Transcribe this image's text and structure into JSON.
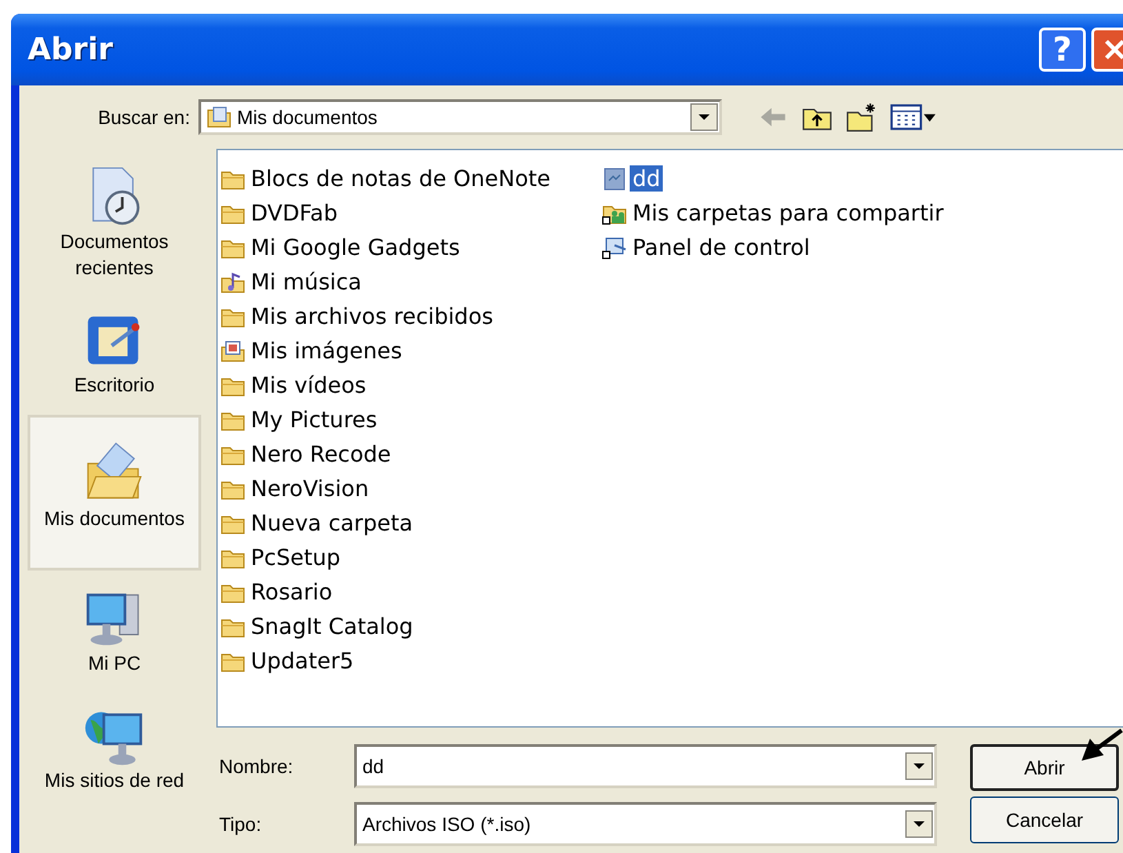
{
  "window": {
    "title": "Abrir",
    "help_button": "?"
  },
  "look_in": {
    "label": "Buscar en:",
    "value": "Mis documentos"
  },
  "places": [
    {
      "kind": "recent",
      "label": "Documentos recientes",
      "selected": false
    },
    {
      "kind": "desktop",
      "label": "Escritorio",
      "selected": false
    },
    {
      "kind": "documents",
      "label": "Mis documentos",
      "selected": true
    },
    {
      "kind": "computer",
      "label": "Mi PC",
      "selected": false
    },
    {
      "kind": "network",
      "label": "Mis sitios de red",
      "selected": false
    }
  ],
  "files": [
    {
      "kind": "folder",
      "name": "Blocs de notas de OneNote",
      "selected": false
    },
    {
      "kind": "folder",
      "name": "DVDFab",
      "selected": false
    },
    {
      "kind": "folder",
      "name": "Mi Google Gadgets",
      "selected": false
    },
    {
      "kind": "music",
      "name": "Mi música",
      "selected": false
    },
    {
      "kind": "folder",
      "name": "Mis archivos recibidos",
      "selected": false
    },
    {
      "kind": "pictures",
      "name": "Mis imágenes",
      "selected": false
    },
    {
      "kind": "folder",
      "name": "Mis vídeos",
      "selected": false
    },
    {
      "kind": "folder",
      "name": "My Pictures",
      "selected": false
    },
    {
      "kind": "folder",
      "name": "Nero Recode",
      "selected": false
    },
    {
      "kind": "folder",
      "name": "NeroVision",
      "selected": false
    },
    {
      "kind": "folder",
      "name": "Nueva carpeta",
      "selected": false
    },
    {
      "kind": "folder",
      "name": "PcSetup",
      "selected": false
    },
    {
      "kind": "folder",
      "name": "Rosario",
      "selected": false
    },
    {
      "kind": "folder",
      "name": "SnagIt Catalog",
      "selected": false
    },
    {
      "kind": "folder",
      "name": "Updater5",
      "selected": false
    },
    {
      "kind": "file",
      "name": "dd",
      "selected": true
    },
    {
      "kind": "shared",
      "name": "Mis carpetas para compartir",
      "selected": false
    },
    {
      "kind": "control",
      "name": "Panel de control",
      "selected": false
    }
  ],
  "file_name": {
    "label": "Nombre:",
    "value": "dd"
  },
  "file_type": {
    "label": "Tipo:",
    "value": "Archivos ISO (*.iso)"
  },
  "buttons": [
    "Abrir",
    "Cancelar"
  ]
}
